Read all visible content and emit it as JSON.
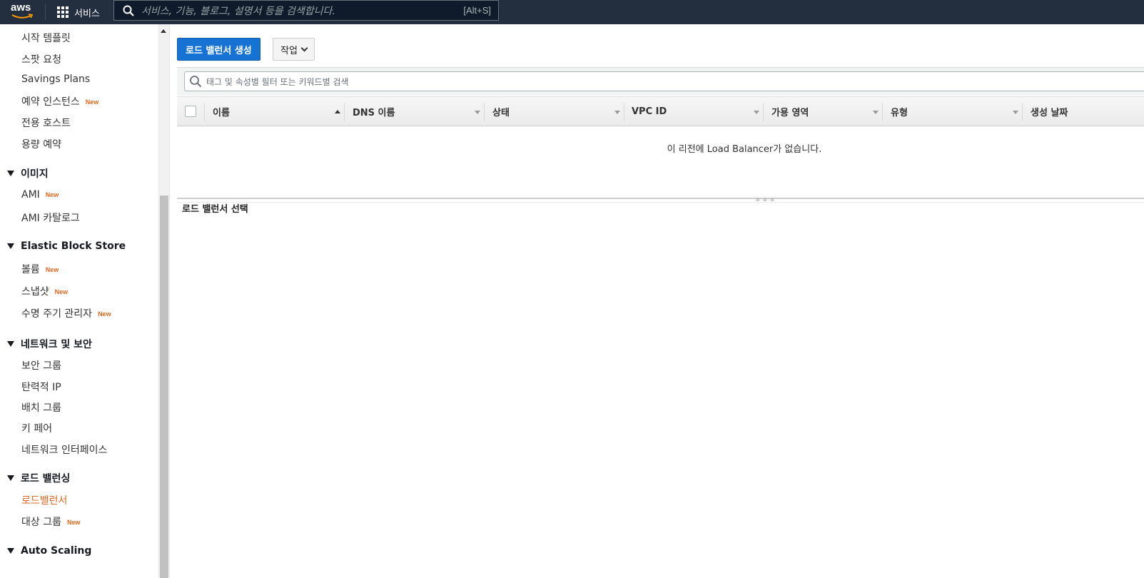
{
  "topbar": {
    "logo_text": "aws",
    "services_label": "서비스",
    "search_placeholder": "서비스, 기능, 블로그, 설명서 등을 검색합니다.",
    "search_shortcut": "[Alt+S]"
  },
  "sidebar": {
    "items": [
      {
        "label": "시작 템플릿"
      },
      {
        "label": "스팟 요청"
      },
      {
        "label": "Savings Plans"
      },
      {
        "label": "예약 인스턴스",
        "badge": "New"
      },
      {
        "label": "전용 호스트"
      },
      {
        "label": "용량 예약"
      }
    ],
    "sections": {
      "images": {
        "title": "이미지",
        "items": [
          {
            "label": "AMI",
            "badge": "New"
          },
          {
            "label": "AMI 카탈로그"
          }
        ]
      },
      "ebs": {
        "title": "Elastic Block Store",
        "items": [
          {
            "label": "볼륨",
            "badge": "New"
          },
          {
            "label": "스냅샷",
            "badge": "New"
          },
          {
            "label": "수명 주기 관리자",
            "badge": "New"
          }
        ]
      },
      "network": {
        "title": "네트워크 및 보안",
        "items": [
          {
            "label": "보안 그룹"
          },
          {
            "label": "탄력적 IP"
          },
          {
            "label": "배치 그룹"
          },
          {
            "label": "키 페어"
          },
          {
            "label": "네트워크 인터페이스"
          }
        ]
      },
      "lb": {
        "title": "로드 밸런싱",
        "items": [
          {
            "label": "로드밸런서",
            "active": true
          },
          {
            "label": "대상 그룹",
            "badge": "New"
          }
        ]
      },
      "autoscaling": {
        "title": "Auto Scaling"
      }
    }
  },
  "main": {
    "create_button": "로드 밸런서 생성",
    "actions_button": "작업",
    "filter_placeholder": "태그 및 속성별 필터 또는 키워드별 검색",
    "columns": [
      "이름",
      "DNS 이름",
      "상태",
      "VPC ID",
      "가용 영역",
      "유형",
      "생성 날짜"
    ],
    "empty_message": "이 리전에 Load Balancer가 없습니다.",
    "detail_title": "로드 밸런서 선택"
  },
  "colors": {
    "topbar_bg": "#232f3e",
    "primary_button": "#1673d3",
    "accent_orange": "#e0681c"
  }
}
